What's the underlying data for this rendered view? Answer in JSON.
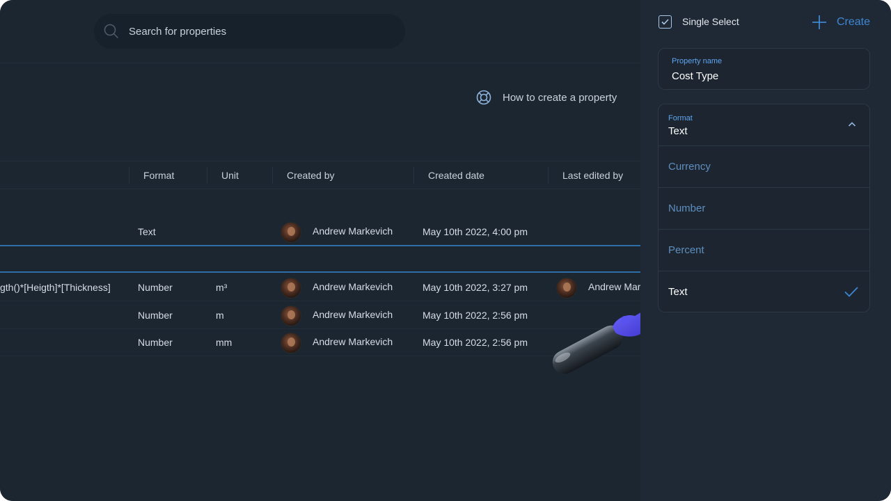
{
  "search": {
    "placeholder": "Search for properties"
  },
  "help": {
    "label": "How to create a property"
  },
  "table": {
    "columns": [
      "Format",
      "Unit",
      "Created by",
      "Created date",
      "Last edited by"
    ],
    "rows": [
      {
        "name": "",
        "format": "Text",
        "unit": "",
        "created_by": "Andrew Markevich",
        "created_date": "May 10th 2022, 4:00 pm",
        "last_edited_by": ""
      },
      {
        "name": "gth()*[Heigth]*[Thickness]",
        "format": "Number",
        "unit": "m³",
        "created_by": "Andrew Markevich",
        "created_date": "May 10th 2022, 3:27 pm",
        "last_edited_by": "Andrew Mar"
      },
      {
        "name": "",
        "format": "Number",
        "unit": "m",
        "created_by": "Andrew Markevich",
        "created_date": "May 10th 2022, 2:56 pm",
        "last_edited_by": ""
      },
      {
        "name": "",
        "format": "Number",
        "unit": "mm",
        "created_by": "Andrew Markevich",
        "created_date": "May 10th 2022, 2:56 pm",
        "last_edited_by": ""
      }
    ]
  },
  "panel": {
    "type_label": "Single Select",
    "type_checked": true,
    "create_label": "Create",
    "property_name": {
      "label": "Property name",
      "value": "Cost Type"
    },
    "format": {
      "label": "Format",
      "value": "Text",
      "options": [
        "Currency",
        "Number",
        "Percent",
        "Text"
      ],
      "selected": "Text"
    }
  },
  "colors": {
    "background": "#1c2631",
    "panel": "#1f2935",
    "accent": "#3e87d3",
    "selected_row_line": "#2d6da8"
  },
  "icons": [
    "search-icon",
    "lifebuoy-icon",
    "checkbox-icon",
    "plus-icon",
    "chevron-up-icon",
    "checkmark-icon"
  ]
}
